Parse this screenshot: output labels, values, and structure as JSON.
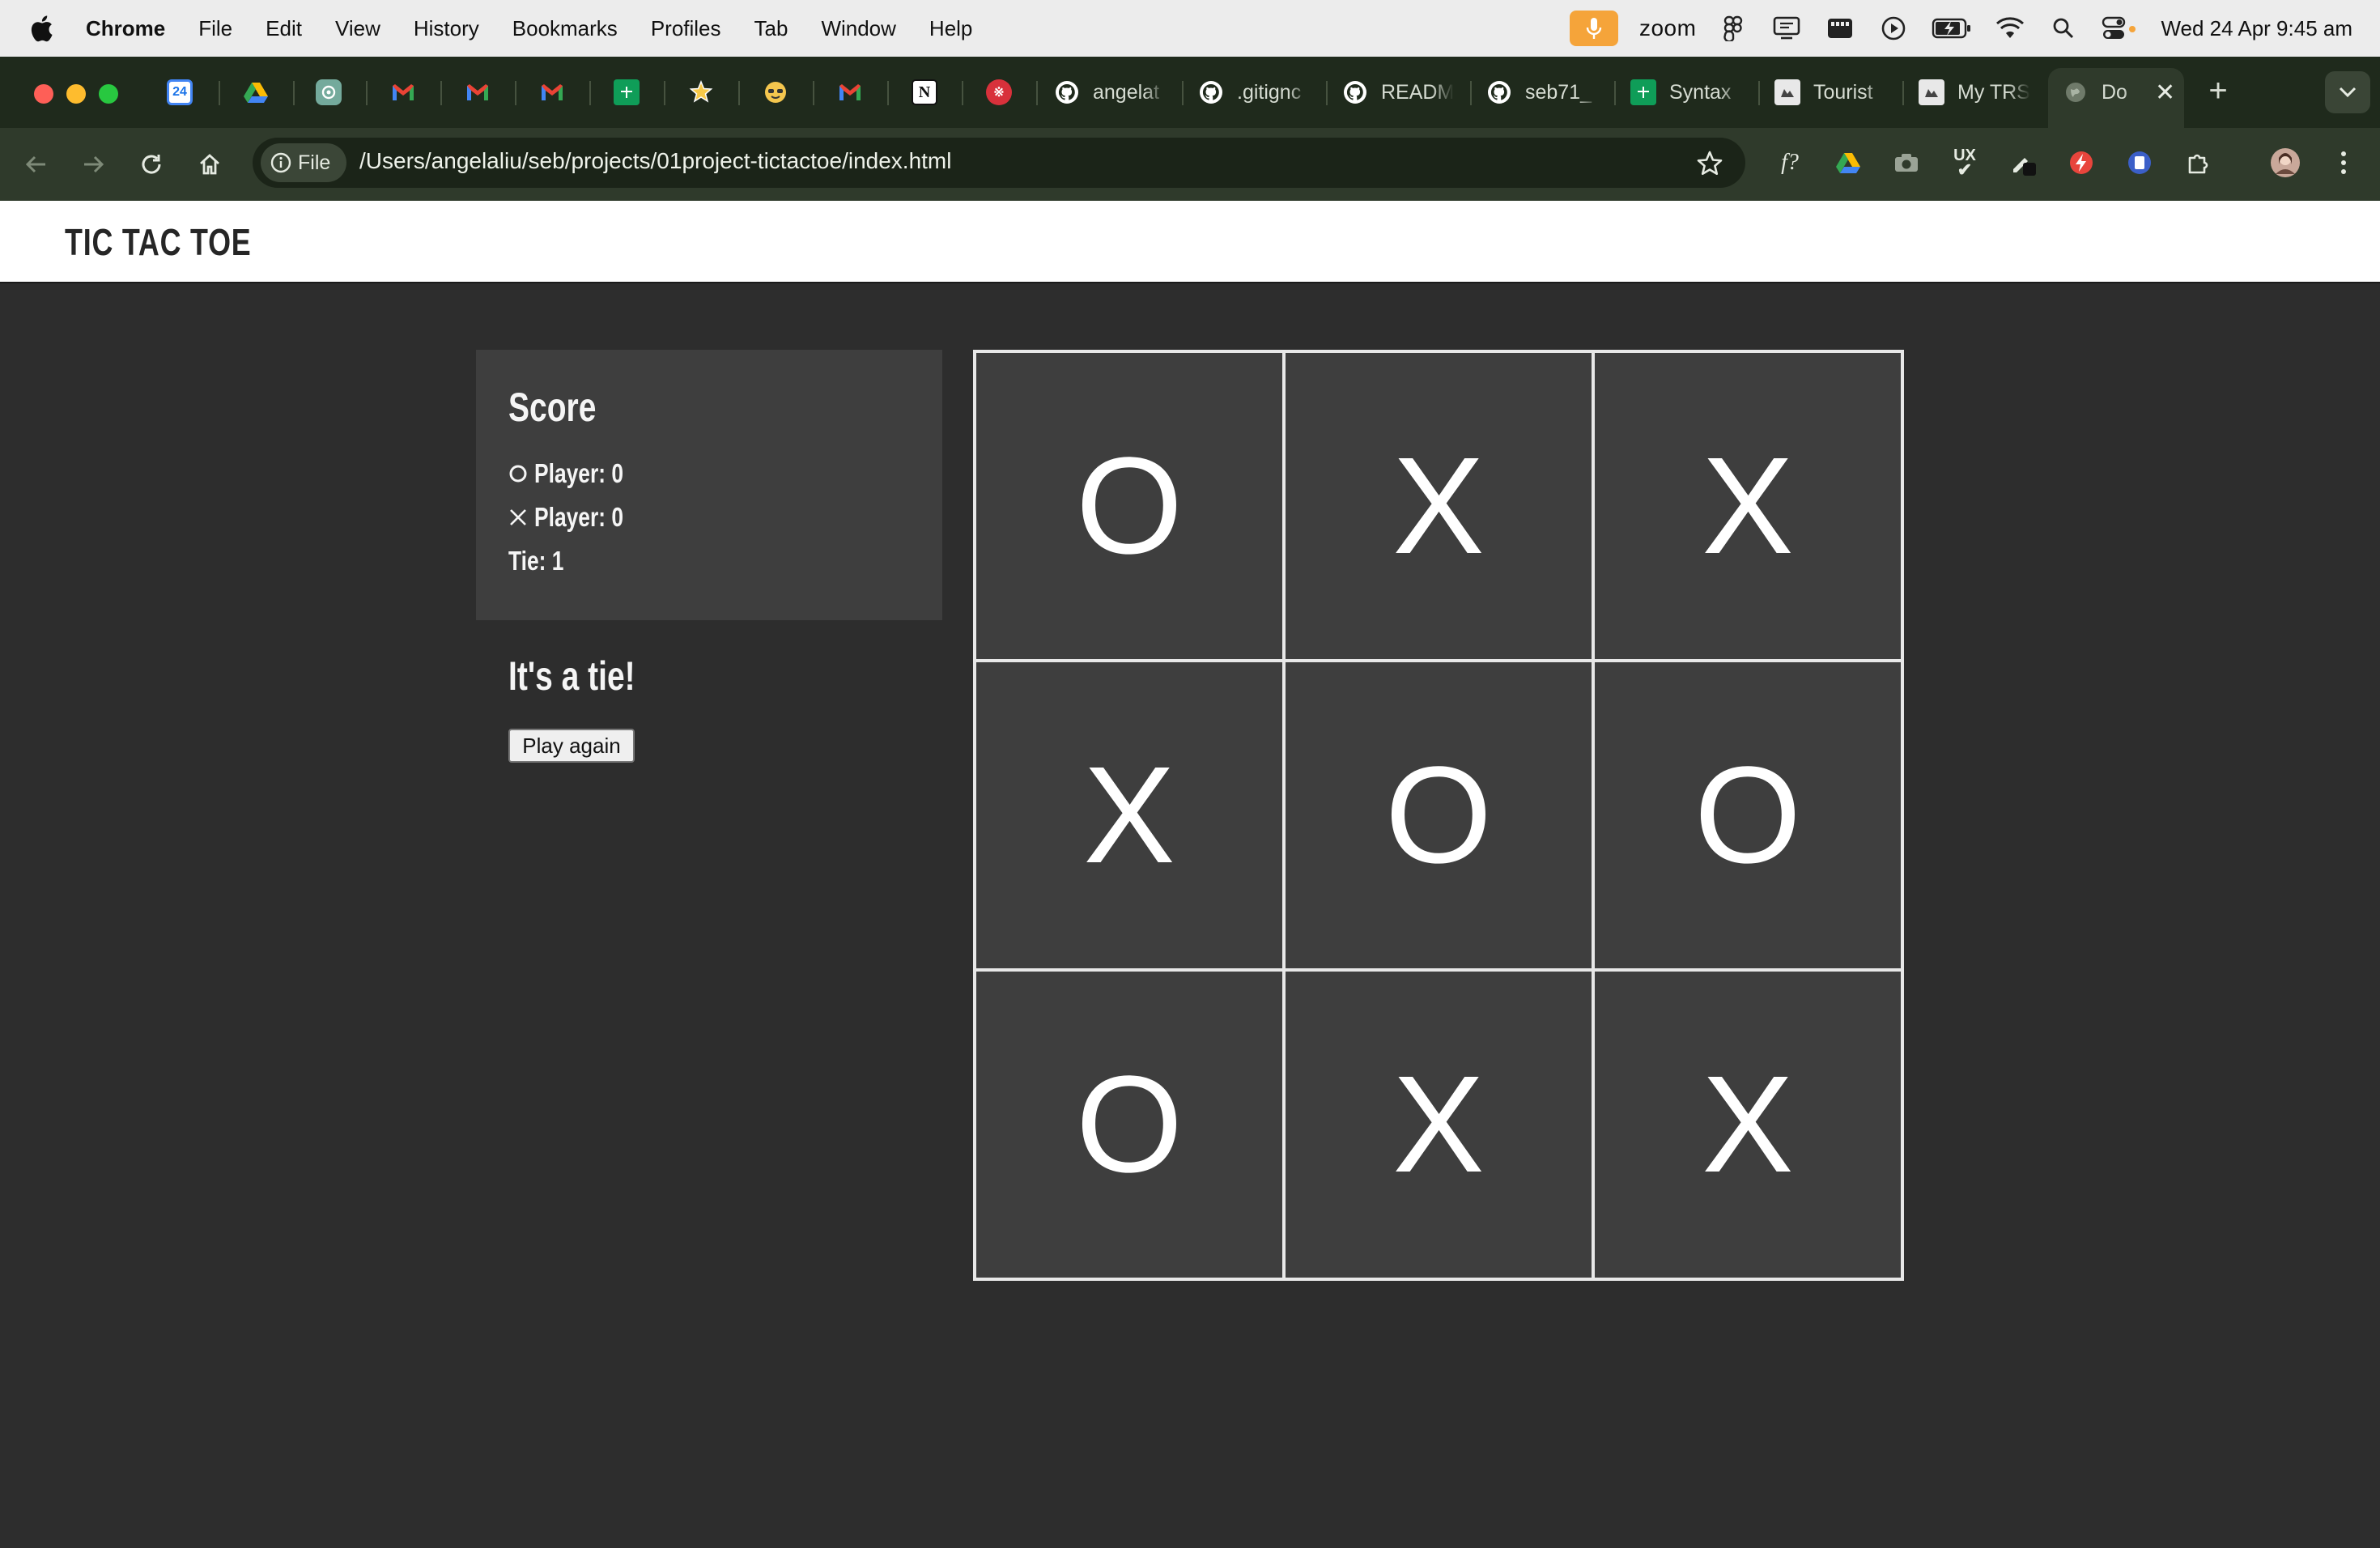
{
  "menubar": {
    "items": [
      "Chrome",
      "File",
      "Edit",
      "View",
      "History",
      "Bookmarks",
      "Profiles",
      "Tab",
      "Window",
      "Help"
    ],
    "zoom_label": "zoom",
    "clock": "Wed 24 Apr  9:45 am"
  },
  "tabs": [
    {
      "label": "",
      "icon": "calendar-icon"
    },
    {
      "label": "",
      "icon": "drive-icon"
    },
    {
      "label": "",
      "icon": "chatgpt-icon"
    },
    {
      "label": "",
      "icon": "gmail-icon"
    },
    {
      "label": "",
      "icon": "gmail-icon"
    },
    {
      "label": "",
      "icon": "gmail-icon"
    },
    {
      "label": "",
      "icon": "sheets-icon"
    },
    {
      "label": "",
      "icon": "star-badge-icon"
    },
    {
      "label": "",
      "icon": "emoji-icon"
    },
    {
      "label": "",
      "icon": "gmail-icon"
    },
    {
      "label": "",
      "icon": "notion-icon"
    },
    {
      "label": "",
      "icon": "red-app-icon"
    },
    {
      "label": "angelat",
      "icon": "github-icon"
    },
    {
      "label": ".gitignc",
      "icon": "github-icon"
    },
    {
      "label": "READM",
      "icon": "github-icon"
    },
    {
      "label": "seb71_",
      "icon": "github-icon"
    },
    {
      "label": "Syntax",
      "icon": "sheets-icon"
    },
    {
      "label": "Tourist",
      "icon": "gov-icon"
    },
    {
      "label": "My TRS",
      "icon": "gov-icon"
    },
    {
      "label": "Do",
      "icon": "globe-icon"
    }
  ],
  "toolbar": {
    "file_chip": "File",
    "url": "/Users/angelaliu/seb/projects/01project-tictactoe/index.html"
  },
  "page": {
    "title": "TIC TAC TOE",
    "score_title": "Score",
    "o_player": "Player: 0",
    "x_player": "Player: 0",
    "tie": "Tie: 1",
    "result": "It's a tie!",
    "play_again": "Play again",
    "board": [
      "O",
      "X",
      "X",
      "X",
      "O",
      "O",
      "O",
      "X",
      "X"
    ]
  },
  "colors": {
    "page_bg": "#2d2d2d",
    "panel_bg": "#3e3e3e",
    "header_bg": "#ffffff",
    "chrome_frame": "#1f2a1c",
    "chrome_toolbar": "#2f3a2b"
  }
}
